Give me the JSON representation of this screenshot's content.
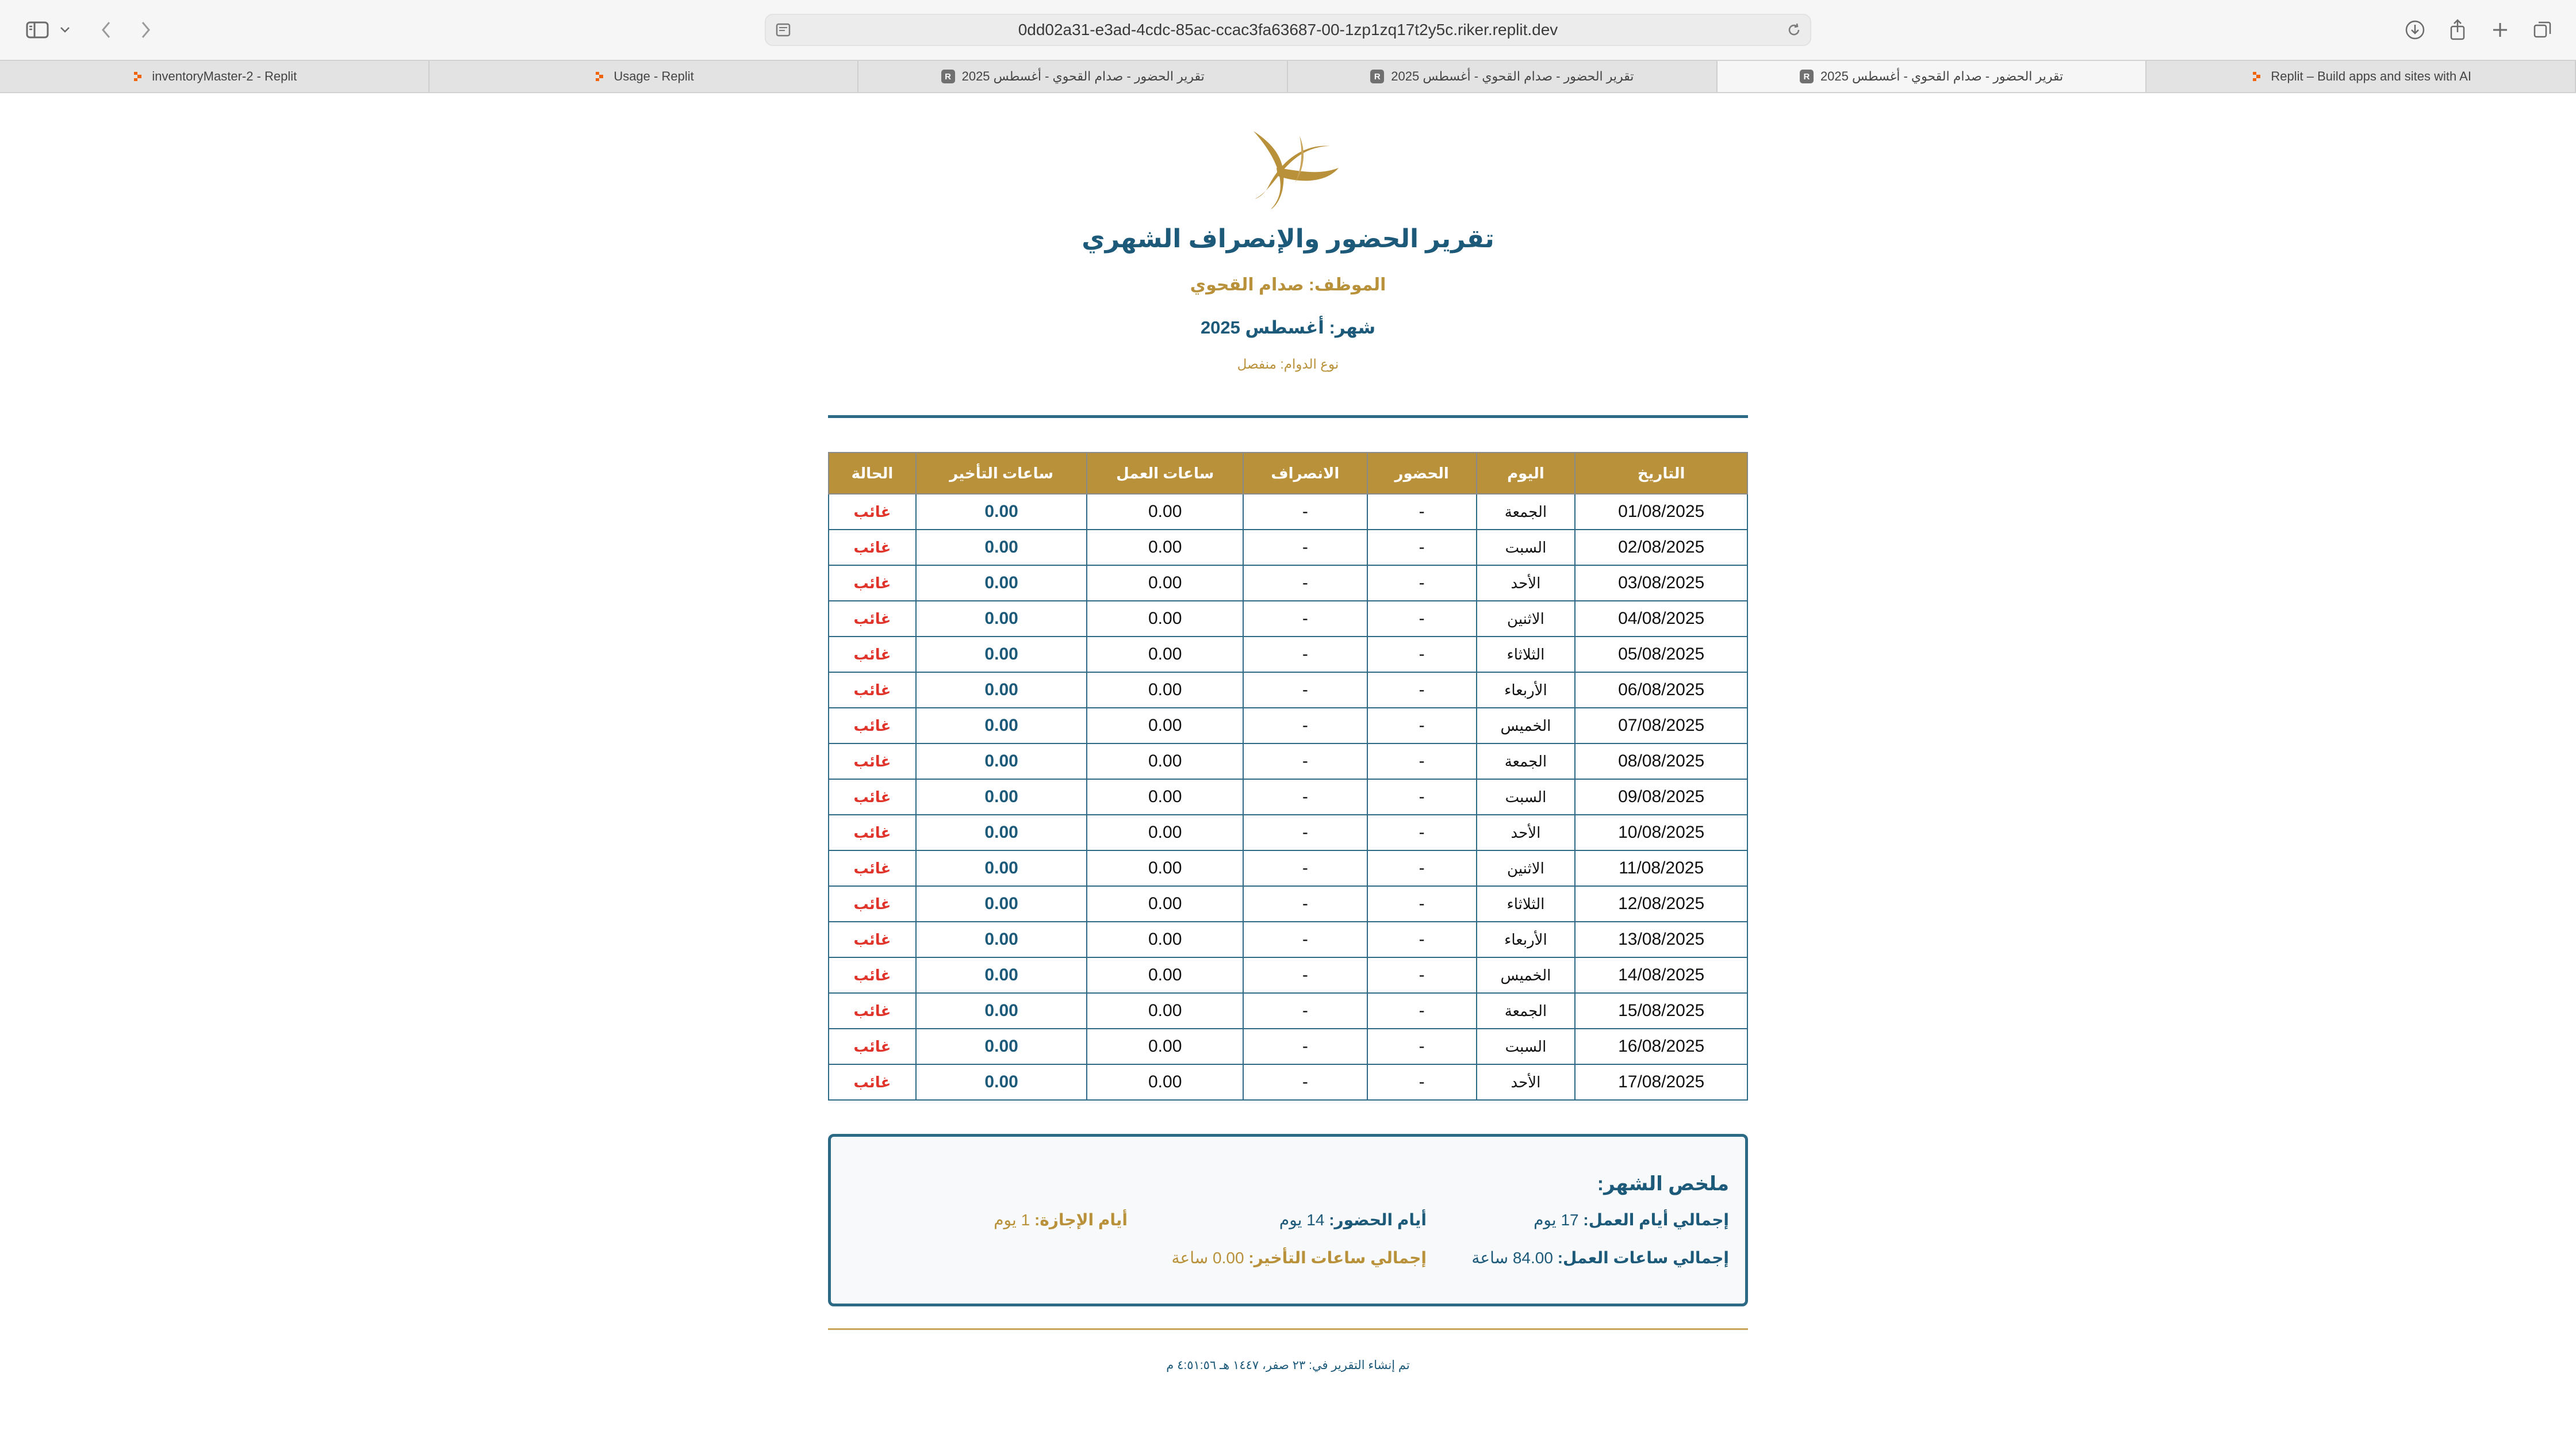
{
  "browser": {
    "url": "0dd02a31-e3ad-4cdc-85ac-ccac3fa63687-00-1zp1zq17t2y5c.riker.replit.dev",
    "tabs": [
      {
        "label": "inventoryMaster-2 - Replit",
        "icon": "replit-icon",
        "active": false
      },
      {
        "label": "Usage - Replit",
        "icon": "replit-icon",
        "active": false
      },
      {
        "label": "تقرير الحضور - صدام القحوي - أغسطس 2025",
        "icon": "r-icon",
        "active": false
      },
      {
        "label": "تقرير الحضور - صدام القحوي - أغسطس 2025",
        "icon": "r-icon",
        "active": false
      },
      {
        "label": "تقرير الحضور - صدام القحوي - أغسطس 2025",
        "icon": "r-icon",
        "active": true
      },
      {
        "label": "Replit – Build apps and sites with AI",
        "icon": "replit-icon",
        "active": false
      }
    ]
  },
  "report": {
    "title": "تقرير الحضور والإنصراف الشهري",
    "employee": "الموظف: صدام القحوي",
    "month": "شهر: أغسطس 2025",
    "shift_type": "نوع الدوام: منفصل",
    "columns": [
      "التاريخ",
      "اليوم",
      "الحضور",
      "الانصراف",
      "ساعات العمل",
      "ساعات التأخير",
      "الحالة"
    ],
    "rows": [
      {
        "date": "01/08/2025",
        "day": "الجمعة",
        "check_in": "-",
        "check_out": "-",
        "work_hours": "0.00",
        "late_hours": "0.00",
        "status": "غائب"
      },
      {
        "date": "02/08/2025",
        "day": "السبت",
        "check_in": "-",
        "check_out": "-",
        "work_hours": "0.00",
        "late_hours": "0.00",
        "status": "غائب"
      },
      {
        "date": "03/08/2025",
        "day": "الأحد",
        "check_in": "-",
        "check_out": "-",
        "work_hours": "0.00",
        "late_hours": "0.00",
        "status": "غائب"
      },
      {
        "date": "04/08/2025",
        "day": "الاثنين",
        "check_in": "-",
        "check_out": "-",
        "work_hours": "0.00",
        "late_hours": "0.00",
        "status": "غائب"
      },
      {
        "date": "05/08/2025",
        "day": "الثلاثاء",
        "check_in": "-",
        "check_out": "-",
        "work_hours": "0.00",
        "late_hours": "0.00",
        "status": "غائب"
      },
      {
        "date": "06/08/2025",
        "day": "الأربعاء",
        "check_in": "-",
        "check_out": "-",
        "work_hours": "0.00",
        "late_hours": "0.00",
        "status": "غائب"
      },
      {
        "date": "07/08/2025",
        "day": "الخميس",
        "check_in": "-",
        "check_out": "-",
        "work_hours": "0.00",
        "late_hours": "0.00",
        "status": "غائب"
      },
      {
        "date": "08/08/2025",
        "day": "الجمعة",
        "check_in": "-",
        "check_out": "-",
        "work_hours": "0.00",
        "late_hours": "0.00",
        "status": "غائب"
      },
      {
        "date": "09/08/2025",
        "day": "السبت",
        "check_in": "-",
        "check_out": "-",
        "work_hours": "0.00",
        "late_hours": "0.00",
        "status": "غائب"
      },
      {
        "date": "10/08/2025",
        "day": "الأحد",
        "check_in": "-",
        "check_out": "-",
        "work_hours": "0.00",
        "late_hours": "0.00",
        "status": "غائب"
      },
      {
        "date": "11/08/2025",
        "day": "الاثنين",
        "check_in": "-",
        "check_out": "-",
        "work_hours": "0.00",
        "late_hours": "0.00",
        "status": "غائب"
      },
      {
        "date": "12/08/2025",
        "day": "الثلاثاء",
        "check_in": "-",
        "check_out": "-",
        "work_hours": "0.00",
        "late_hours": "0.00",
        "status": "غائب"
      },
      {
        "date": "13/08/2025",
        "day": "الأربعاء",
        "check_in": "-",
        "check_out": "-",
        "work_hours": "0.00",
        "late_hours": "0.00",
        "status": "غائب"
      },
      {
        "date": "14/08/2025",
        "day": "الخميس",
        "check_in": "-",
        "check_out": "-",
        "work_hours": "0.00",
        "late_hours": "0.00",
        "status": "غائب"
      },
      {
        "date": "15/08/2025",
        "day": "الجمعة",
        "check_in": "-",
        "check_out": "-",
        "work_hours": "0.00",
        "late_hours": "0.00",
        "status": "غائب"
      },
      {
        "date": "16/08/2025",
        "day": "السبت",
        "check_in": "-",
        "check_out": "-",
        "work_hours": "0.00",
        "late_hours": "0.00",
        "status": "غائب"
      },
      {
        "date": "17/08/2025",
        "day": "الأحد",
        "check_in": "-",
        "check_out": "-",
        "work_hours": "0.00",
        "late_hours": "0.00",
        "status": "غائب"
      }
    ],
    "summary": {
      "title": "ملخص الشهر:",
      "total_work_days_label": "إجمالي أيام العمل:",
      "total_work_days_value": "17 يوم",
      "attendance_days_label": "أيام الحضور:",
      "attendance_days_value": "14 يوم",
      "leave_days_label": "أيام الإجازة:",
      "leave_days_value": "1 يوم",
      "total_work_hours_label": "إجمالي ساعات العمل:",
      "total_work_hours_value": "84.00 ساعة",
      "total_late_hours_label": "إجمالي ساعات التأخير:",
      "total_late_hours_value": "0.00 ساعة"
    },
    "generated_at": "تم إنشاء التقرير في: ٢٣ صفر، ١٤٤٧ هـ ٤:٥١:٥٦ م"
  },
  "colors": {
    "primary_blue": "#1d5a7a",
    "accent_gold": "#b8913a",
    "absent_red": "#e0342b"
  }
}
